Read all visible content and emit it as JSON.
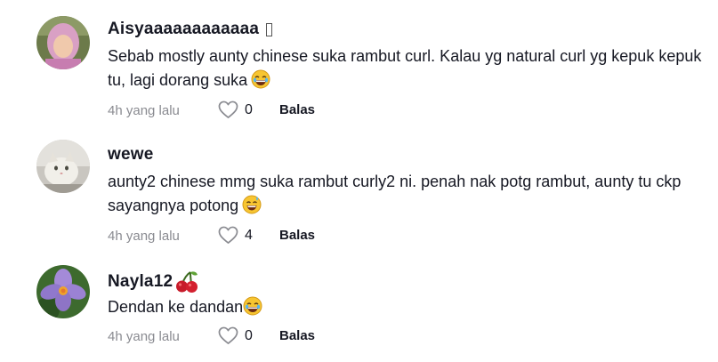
{
  "comments": [
    {
      "username": "Aisyaaaaaaaaaaaa",
      "badge_icon": "unknown-glyph-box",
      "text": "Sebab mostly aunty chinese suka rambut curl. Kalau yg natural curl yg kepuk kepuk tu, lagi dorang suka",
      "emoji": "laughing-emoji",
      "time": "4h yang lalu",
      "likes": "0",
      "reply_label": "Balas"
    },
    {
      "username": "wewe",
      "text": "aunty2 chinese mmg suka rambut curly2 ni. penah nak potg rambut, aunty tu ckp sayangnya potong",
      "emoji": "sweat-smile-emoji",
      "time": "4h yang lalu",
      "likes": "4",
      "reply_label": "Balas"
    },
    {
      "username": "Nayla12",
      "username_emoji": "cherries-emoji",
      "text": "Dendan ke dandan",
      "emoji": "laughing-emoji",
      "time": "4h yang lalu",
      "likes": "0",
      "reply_label": "Balas"
    }
  ]
}
